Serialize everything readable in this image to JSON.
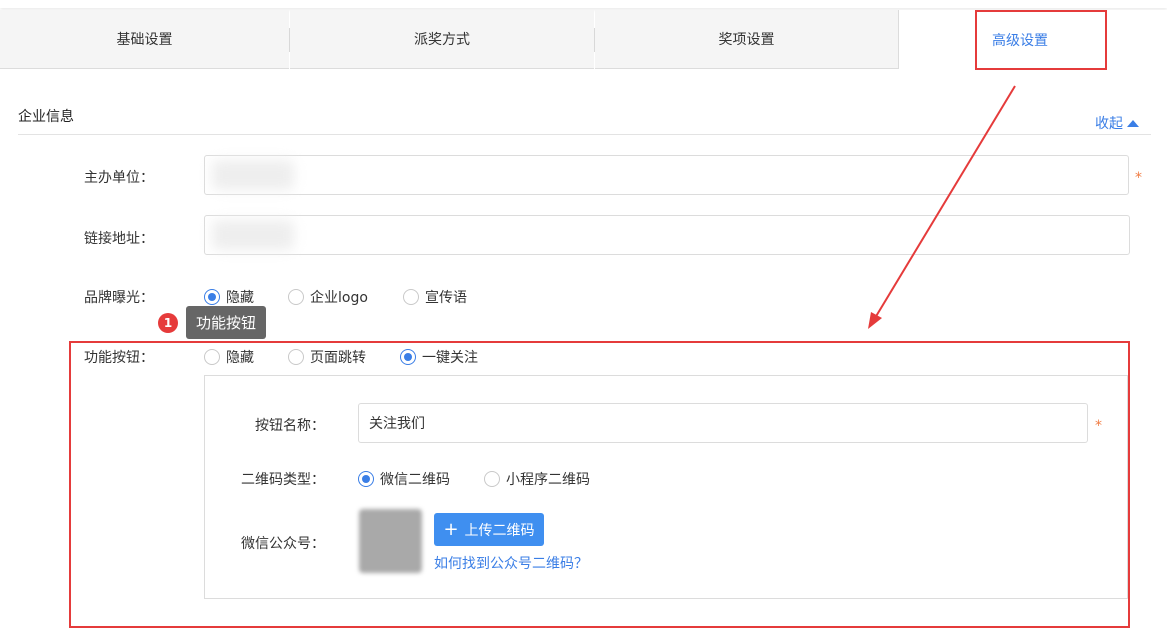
{
  "tabs": [
    {
      "label": "基础设置",
      "active": false
    },
    {
      "label": "派奖方式",
      "active": false
    },
    {
      "label": "奖项设置",
      "active": false
    },
    {
      "label": "高级设置",
      "active": true
    }
  ],
  "section": {
    "title": "企业信息",
    "collapse_label": "收起"
  },
  "fields": {
    "organizer": {
      "label": "主办单位：",
      "required_mark": "*"
    },
    "link": {
      "label": "链接地址："
    },
    "brand_exposure": {
      "label": "品牌曝光：",
      "options": [
        "隐藏",
        "企业logo",
        "宣传语"
      ],
      "selected": "隐藏"
    },
    "function_button": {
      "label": "功能按钮：",
      "options": [
        "隐藏",
        "页面跳转",
        "一键关注"
      ],
      "selected": "一键关注"
    }
  },
  "tooltip": {
    "badge": "1",
    "text": "功能按钮"
  },
  "follow_panel": {
    "button_name": {
      "label": "按钮名称：",
      "value": "关注我们",
      "required_mark": "*"
    },
    "qr_type": {
      "label": "二维码类型：",
      "options": [
        "微信二维码",
        "小程序二维码"
      ],
      "selected": "微信二维码"
    },
    "wechat_account": {
      "label": "微信公众号：",
      "upload_label": "上传二维码",
      "help_link": "如何找到公众号二维码？"
    }
  },
  "colors": {
    "accent": "#3a7ee6",
    "annotation_red": "#e53b3b",
    "upload_button": "#3f8ff0",
    "required": "#f07b42"
  }
}
